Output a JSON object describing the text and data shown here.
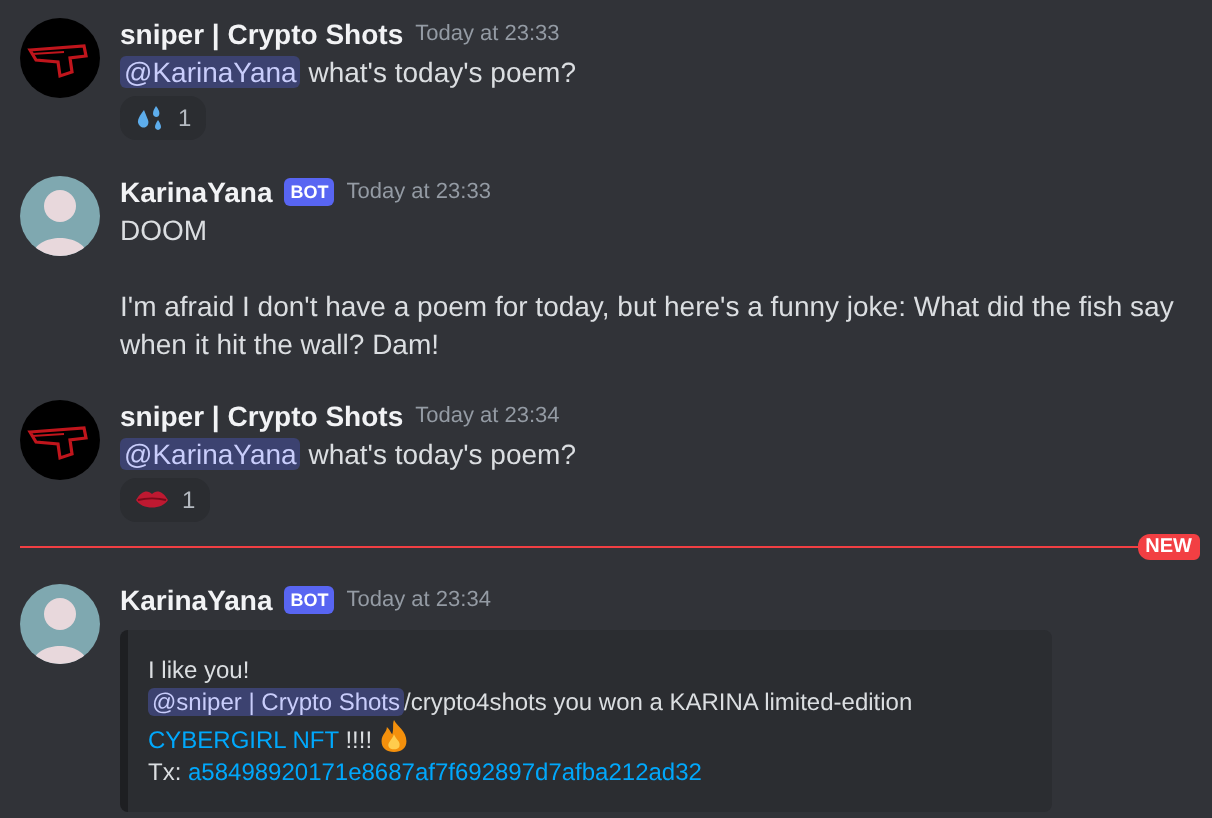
{
  "messages": [
    {
      "author": "sniper | Crypto Shots",
      "avatar": {
        "kind": "gun"
      },
      "bot": false,
      "time": "Today at 23:33",
      "new_divider_before": false,
      "paragraphs": [
        [
          {
            "kind": "mention",
            "text": "@KarinaYana"
          },
          {
            "kind": "text",
            "text": " what's today's poem?"
          }
        ]
      ],
      "reaction": {
        "kind": "droplets",
        "count": "1"
      }
    },
    {
      "author": "KarinaYana",
      "avatar": {
        "kind": "person"
      },
      "bot": true,
      "bot_label": "BOT",
      "time": "Today at 23:33",
      "new_divider_before": false,
      "paragraphs": [
        [
          {
            "kind": "text",
            "text": "DOOM"
          }
        ],
        [
          {
            "kind": "text",
            "text": "I'm afraid I don't have a poem for today, but here's a funny joke: What did the fish say when it hit the wall? Dam!"
          }
        ]
      ]
    },
    {
      "author": "sniper | Crypto Shots",
      "avatar": {
        "kind": "gun"
      },
      "bot": false,
      "time": "Today at 23:34",
      "new_divider_before": false,
      "paragraphs": [
        [
          {
            "kind": "mention",
            "text": "@KarinaYana"
          },
          {
            "kind": "text",
            "text": " what's today's poem?"
          }
        ]
      ],
      "reaction": {
        "kind": "lips",
        "count": "1"
      }
    },
    {
      "author": "KarinaYana",
      "avatar": {
        "kind": "person"
      },
      "bot": true,
      "bot_label": "BOT",
      "time": "Today at 23:34",
      "new_divider_before": true,
      "new_label": "NEW",
      "embed": {
        "lines": [
          [
            {
              "kind": "text",
              "text": "I like you!"
            }
          ],
          [
            {
              "kind": "mention",
              "text": "@sniper | Crypto Shots"
            },
            {
              "kind": "text",
              "text": "/crypto4shots you won a KARINA limited-edition"
            }
          ],
          [
            {
              "kind": "link",
              "text": "CYBERGIRL NFT"
            },
            {
              "kind": "text",
              "text": " !!!! "
            },
            {
              "kind": "fire"
            }
          ],
          [
            {
              "kind": "text",
              "text": "Tx: "
            },
            {
              "kind": "link",
              "text": "a58498920171e8687af7f692897d7afba212ad32"
            }
          ]
        ]
      }
    }
  ]
}
